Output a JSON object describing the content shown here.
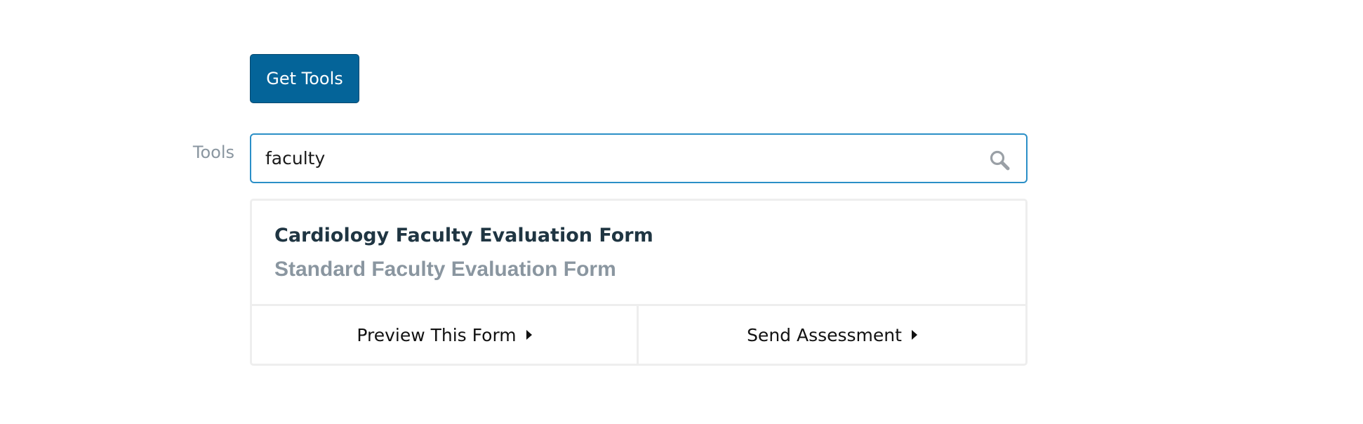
{
  "header": {
    "get_tools_label": "Get Tools"
  },
  "tools_field": {
    "label": "Tools",
    "value": "faculty",
    "search_icon": "search-icon"
  },
  "results": {
    "items": [
      {
        "label": "Cardiology Faculty Evaluation Form",
        "state": "highlighted"
      },
      {
        "label": "Standard Faculty Evaluation Form",
        "state": "muted"
      }
    ],
    "actions": {
      "preview_label": "Preview This Form",
      "send_label": "Send Assessment",
      "caret_icon": "caret-right-icon"
    }
  },
  "colors": {
    "primary_button": "#046499",
    "focus_border": "#2b8fc7",
    "label_gray": "#8a96a0",
    "primary_text": "#1f3542"
  }
}
